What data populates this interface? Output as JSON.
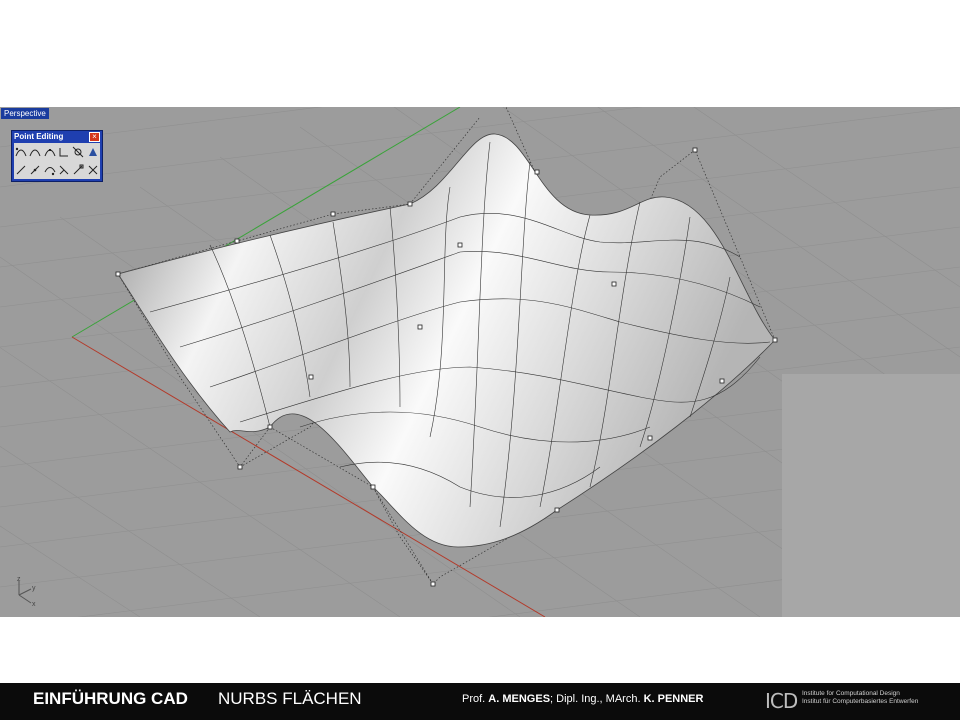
{
  "viewport": {
    "label": "Perspective"
  },
  "toolbar": {
    "title": "Point Editing",
    "close": "×",
    "buttons": [
      "points-on",
      "points-off",
      "insert-knot",
      "remove-knot",
      "handlebar",
      "smooth",
      "move-uvn",
      "edit-weight",
      "insert-point",
      "remove-point",
      "soft-edit",
      "show-edit-points"
    ]
  },
  "axes": {
    "x": "x",
    "y": "y",
    "z": "z"
  },
  "footer": {
    "title": "EINFÜHRUNG CAD",
    "subtitle": "NURBS FLÄCHEN",
    "credits_prefix": "Prof. ",
    "credits_name1": "A. MENGES",
    "credits_mid": "; Dipl. Ing., MArch. ",
    "credits_name2": "K. PENNER",
    "logo_mark": "ICD",
    "logo_line1": "Institute for Computational Design",
    "logo_line2": "Institut für Computerbasiertes Entwerfen"
  },
  "colors": {
    "viewport_bg": "#9c9c9c",
    "x_axis": "#b33a2a",
    "y_axis": "#3aa33a",
    "footer_bg": "#0b0b0b",
    "toolbar": "#1f3fb0"
  }
}
